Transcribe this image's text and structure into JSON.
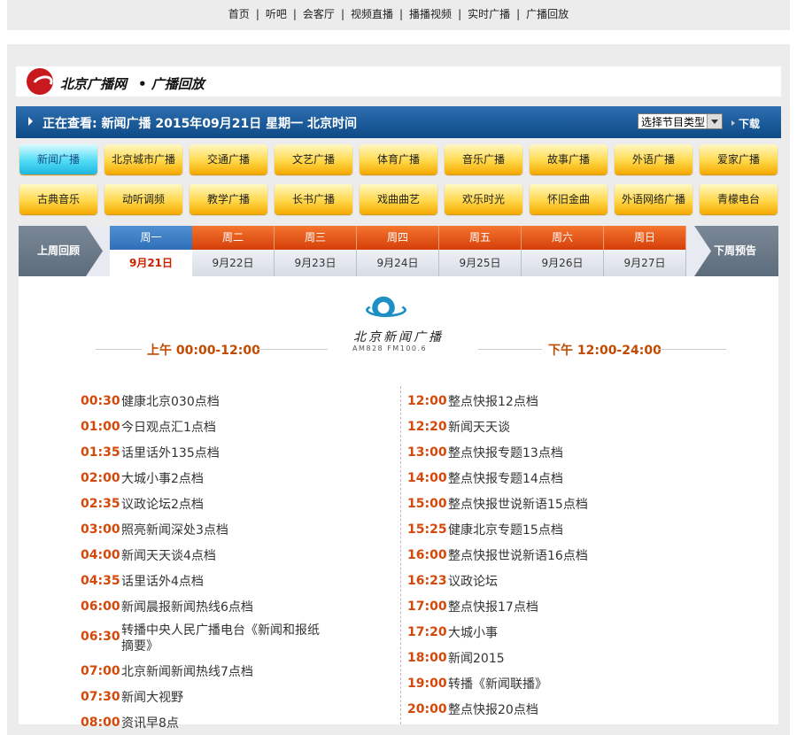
{
  "top_nav": [
    "首页",
    "听吧",
    "会客厅",
    "视频直播",
    "播播视频",
    "实时广播",
    "广播回放"
  ],
  "header": {
    "site_name": "北京广播网",
    "section": "• 广播回放"
  },
  "info_bar": {
    "title": "正在查看: 新闻广播  2015年09月21日  星期一  北京时间",
    "select_value": "选择节目类型",
    "download_label": "下载"
  },
  "channels": [
    {
      "label": "新闻广播",
      "active": true
    },
    {
      "label": "北京城市广播"
    },
    {
      "label": "交通广播"
    },
    {
      "label": "文艺广播"
    },
    {
      "label": "体育广播"
    },
    {
      "label": "音乐广播"
    },
    {
      "label": "故事广播"
    },
    {
      "label": "外语广播"
    },
    {
      "label": "爱家广播"
    },
    {
      "label": "古典音乐"
    },
    {
      "label": "动听调频"
    },
    {
      "label": "教学广播"
    },
    {
      "label": "长书广播"
    },
    {
      "label": "戏曲曲艺"
    },
    {
      "label": "欢乐时光"
    },
    {
      "label": "怀旧金曲"
    },
    {
      "label": "外语网络广播"
    },
    {
      "label": "青檬电台"
    }
  ],
  "week": {
    "prev_label": "上周回顾",
    "next_label": "下周预告",
    "days": [
      {
        "name": "周一",
        "date": "9月21日",
        "active": true
      },
      {
        "name": "周二",
        "date": "9月22日"
      },
      {
        "name": "周三",
        "date": "9月23日"
      },
      {
        "name": "周四",
        "date": "9月24日"
      },
      {
        "name": "周五",
        "date": "9月25日"
      },
      {
        "name": "周六",
        "date": "9月26日"
      },
      {
        "name": "周日",
        "date": "9月27日"
      }
    ]
  },
  "station": {
    "name": "北京新闻广播",
    "freq": "AM828 FM100.6",
    "logo_color": "#1e8fc4"
  },
  "schedule": {
    "am_header": "上午   00:00-12:00",
    "pm_header": "下午   12:00-24:00",
    "am": [
      {
        "time": "00:30",
        "name": "健康北京030点档"
      },
      {
        "time": "01:00",
        "name": "今日观点汇1点档"
      },
      {
        "time": "01:35",
        "name": "话里话外135点档"
      },
      {
        "time": "02:00",
        "name": "大城小事2点档"
      },
      {
        "time": "02:35",
        "name": "议政论坛2点档"
      },
      {
        "time": "03:00",
        "name": "照亮新闻深处3点档"
      },
      {
        "time": "04:00",
        "name": "新闻天天谈4点档"
      },
      {
        "time": "04:35",
        "name": "话里话外4点档"
      },
      {
        "time": "06:00",
        "name": "新闻晨报新闻热线6点档"
      },
      {
        "time": "06:30",
        "name": "转播中央人民广播电台《新闻和报纸摘要》"
      },
      {
        "time": "07:00",
        "name": "北京新闻新闻热线7点档"
      },
      {
        "time": "07:30",
        "name": "新闻大视野"
      },
      {
        "time": "08:00",
        "name": "资讯早8点"
      }
    ],
    "pm": [
      {
        "time": "12:00",
        "name": "整点快报12点档"
      },
      {
        "time": "12:20",
        "name": "新闻天天谈"
      },
      {
        "time": "13:00",
        "name": "整点快报专题13点档"
      },
      {
        "time": "14:00",
        "name": "整点快报专题14点档"
      },
      {
        "time": "15:00",
        "name": "整点快报世说新语15点档"
      },
      {
        "time": "15:25",
        "name": "健康北京专题15点档"
      },
      {
        "time": "16:00",
        "name": "整点快报世说新语16点档"
      },
      {
        "time": "16:23",
        "name": "议政论坛"
      },
      {
        "time": "17:00",
        "name": "整点快报17点档"
      },
      {
        "time": "17:20",
        "name": "大城小事"
      },
      {
        "time": "18:00",
        "name": "新闻2015"
      },
      {
        "time": "19:00",
        "name": "转播《新闻联播》"
      },
      {
        "time": "20:00",
        "name": "整点快报20点档"
      }
    ]
  },
  "colors": {
    "accent_blue": "#0e4a86",
    "time_orange": "#d4480a",
    "day_orange": "#d53e09"
  }
}
